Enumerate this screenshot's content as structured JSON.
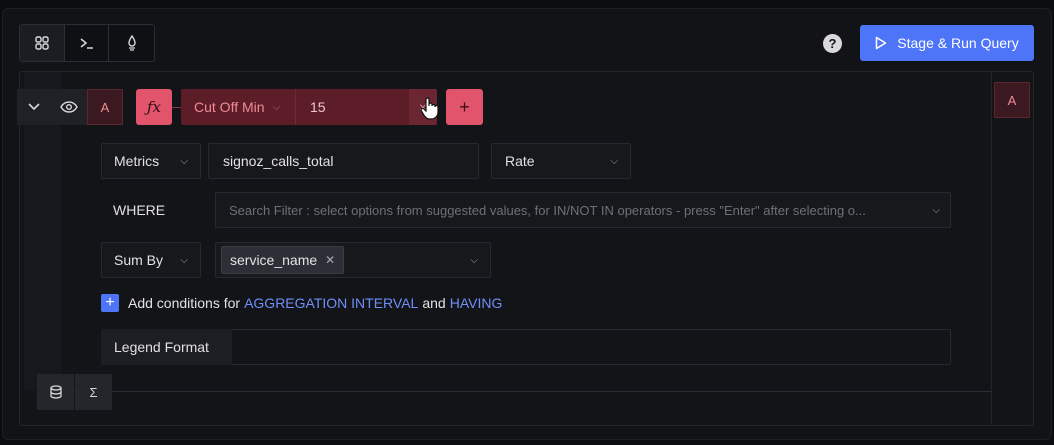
{
  "toolbar": {
    "tabs": [
      {
        "icon": "query-builder-icon",
        "glyph": "⌘"
      },
      {
        "icon": "terminal-icon",
        "glyph": "≻_"
      },
      {
        "icon": "promql-icon",
        "glyph": "🜂"
      }
    ],
    "help_glyph": "?",
    "run_label": "Stage & Run Query",
    "accent": "#4e74f8"
  },
  "query": {
    "name": "A",
    "function": {
      "name": "Cut Off Min",
      "value": "15",
      "remove_glyph": "×",
      "add_glyph": "+",
      "fx_glyph": "ƒx",
      "color": "#e1546c"
    },
    "aggregate_attribute": {
      "label": "Metrics",
      "metric": "signoz_calls_total",
      "operator": "Rate"
    },
    "where": {
      "label": "WHERE",
      "placeholder": "Search Filter : select options from suggested values, for IN/NOT IN operators - press \"Enter\" after selecting o..."
    },
    "group_by": {
      "label": "Sum By",
      "tags": [
        "service_name"
      ]
    },
    "conditions": {
      "prefix": "Add conditions for",
      "interval_link": "AGGREGATION INTERVAL",
      "conjunction": "and",
      "having_link": "HAVING"
    },
    "legend": {
      "label": "Legend Format",
      "value": ""
    }
  },
  "bottom_tabs": [
    {
      "icon": "database-icon",
      "glyph": "⛁"
    },
    {
      "icon": "formula-icon",
      "glyph": "Σ"
    }
  ]
}
